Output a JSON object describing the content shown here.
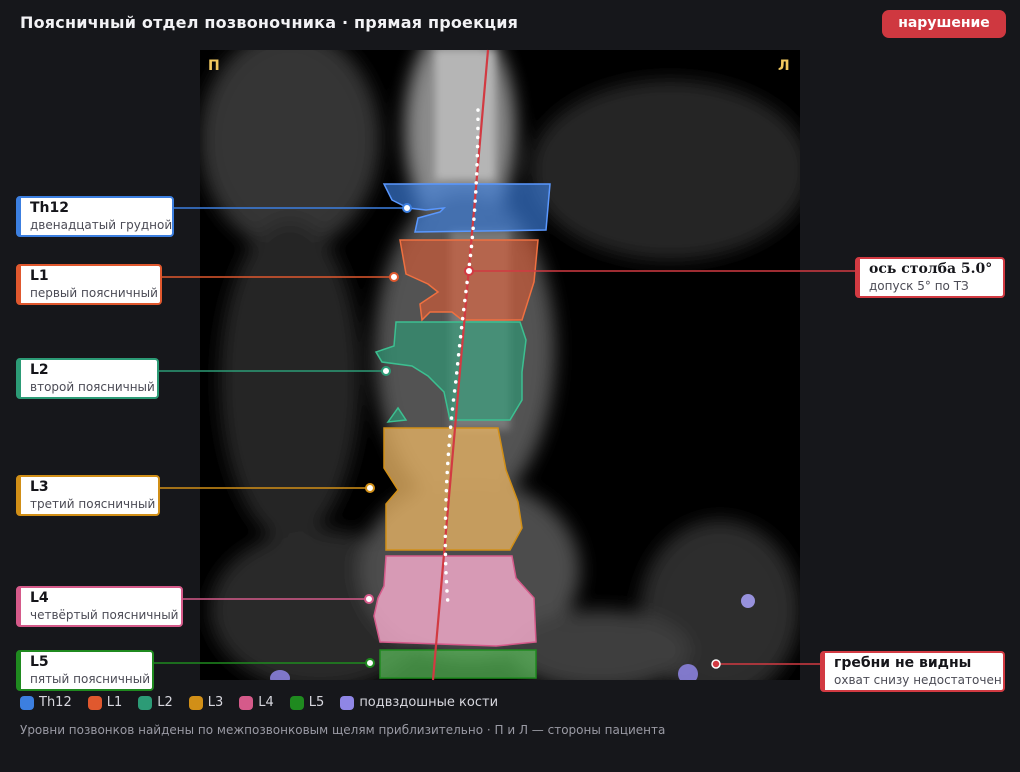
{
  "header": {
    "title": "Поясничный отдел позвоночника · прямая проекция",
    "status_badge": "нарушение"
  },
  "image": {
    "side_right_patient": "П",
    "side_left_patient": "Л"
  },
  "vertebrae": [
    {
      "id": "Th12",
      "name": "двенадцатый грудной",
      "color": "#3c7fe0"
    },
    {
      "id": "L1",
      "name": "первый поясничный",
      "color": "#e0582e"
    },
    {
      "id": "L2",
      "name": "второй поясничный",
      "color": "#2c9b76"
    },
    {
      "id": "L3",
      "name": "третий поясничный",
      "color": "#d18f17"
    },
    {
      "id": "L4",
      "name": "четвёртый поясничный",
      "color": "#d55a8a"
    },
    {
      "id": "L5",
      "name": "пятый поясничный",
      "color": "#1f8a1f"
    }
  ],
  "axis_callout": {
    "title": "ось столба 5.0°",
    "subtitle": "допуск 5° по ТЗ",
    "angle_deg": 5.0,
    "tolerance_deg": 5,
    "color": "#d23a42"
  },
  "iliac_callout": {
    "title": "гребни не видны",
    "subtitle": "охват снизу недостаточен",
    "color": "#d23a42"
  },
  "legend": [
    {
      "label": "Th12",
      "color": "#3c7fe0"
    },
    {
      "label": "L1",
      "color": "#e0582e"
    },
    {
      "label": "L2",
      "color": "#2c9b76"
    },
    {
      "label": "L3",
      "color": "#d18f17"
    },
    {
      "label": "L4",
      "color": "#d55a8a"
    },
    {
      "label": "L5",
      "color": "#1f8a1f"
    },
    {
      "label": "подвздошные кости",
      "color": "#8f86e6"
    }
  ],
  "footnote": "Уровни позвонков найдены по межпозвонковым щелям приблизительно · П и Л — стороны пациента"
}
